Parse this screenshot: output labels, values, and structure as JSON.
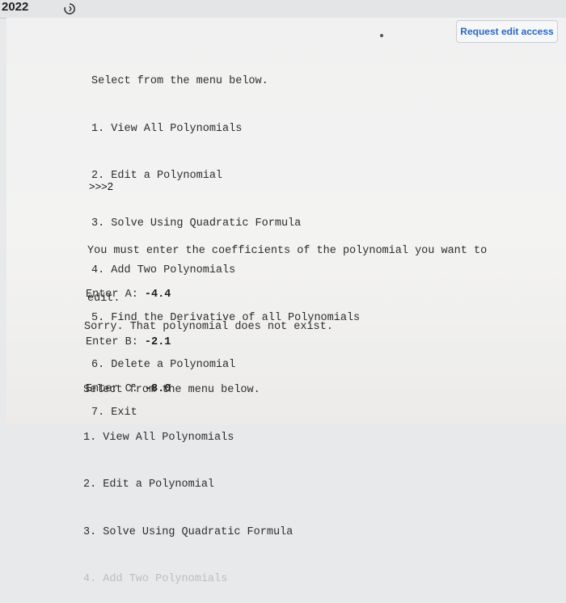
{
  "header": {
    "year": "2022",
    "request_button": "Request edit access"
  },
  "menu1": {
    "title": "Select from the menu below.",
    "items": [
      "1. View All Polynomials",
      "2. Edit a Polynomial",
      "3. Solve Using Quadratic Formula",
      "4. Add Two Polynomials",
      "5. Find the Derivative of all Polynomials",
      "6. Delete a Polynomial",
      "7. Exit"
    ]
  },
  "prompt_input": ">>>2",
  "instruction": {
    "line1": "You must enter the coefficients of the polynomial you want to",
    "line2": "edit."
  },
  "entries": [
    {
      "label": "Enter A: ",
      "value": "-4.4"
    },
    {
      "label": "Enter B: ",
      "value": "-2.1"
    },
    {
      "label": "Enter C: ",
      "value": "-8.0"
    }
  ],
  "error_message": "Sorry. That polynomial does not exist.",
  "menu2": {
    "title": "Select from the menu below.",
    "items": [
      "1. View All Polynomials",
      "2. Edit a Polynomial",
      "3. Solve Using Quadratic Formula",
      "4. Add Two Polynomials"
    ]
  }
}
